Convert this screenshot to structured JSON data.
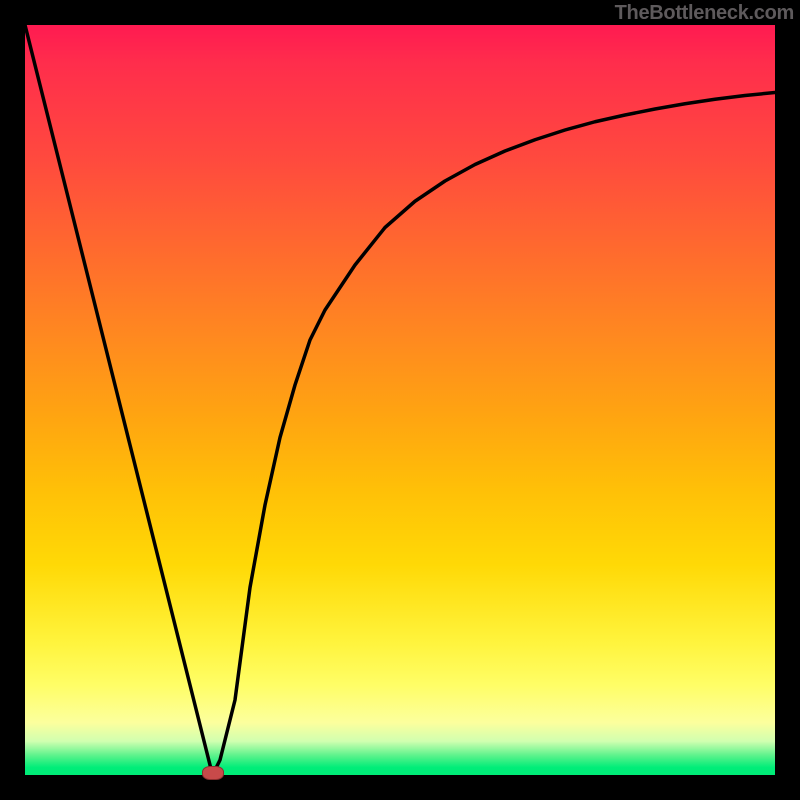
{
  "credit": "TheBottleneck.com",
  "chart_data": {
    "type": "line",
    "title": "",
    "xlabel": "",
    "ylabel": "",
    "xlim": [
      0,
      100
    ],
    "ylim": [
      0,
      100
    ],
    "grid": false,
    "legend": false,
    "curve": {
      "name": "bottleneck-curve",
      "x": [
        0,
        2,
        4,
        6,
        8,
        10,
        12,
        14,
        16,
        18,
        20,
        22,
        24,
        25,
        26,
        28,
        30,
        32,
        34,
        36,
        38,
        40,
        44,
        48,
        52,
        56,
        60,
        64,
        68,
        72,
        76,
        80,
        84,
        88,
        92,
        96,
        100
      ],
      "values": [
        100,
        92,
        84,
        76,
        68,
        60,
        52,
        44,
        36,
        28,
        20,
        12,
        4,
        0,
        2,
        10,
        25,
        36,
        45,
        52,
        58,
        62,
        68,
        73,
        76.5,
        79.2,
        81.4,
        83.2,
        84.7,
        86.0,
        87.1,
        88.0,
        88.8,
        89.5,
        90.1,
        90.6,
        91.0
      ]
    },
    "marker": {
      "x": 25,
      "y": 0,
      "color": "#c84a4a"
    },
    "gradient_stops": [
      {
        "pct": 0,
        "color": "#ff1a51"
      },
      {
        "pct": 18,
        "color": "#ff4a3e"
      },
      {
        "pct": 42,
        "color": "#ff8a1f"
      },
      {
        "pct": 72,
        "color": "#ffd906"
      },
      {
        "pct": 93,
        "color": "#fcff9d"
      },
      {
        "pct": 100,
        "color": "#00eb77"
      }
    ]
  }
}
